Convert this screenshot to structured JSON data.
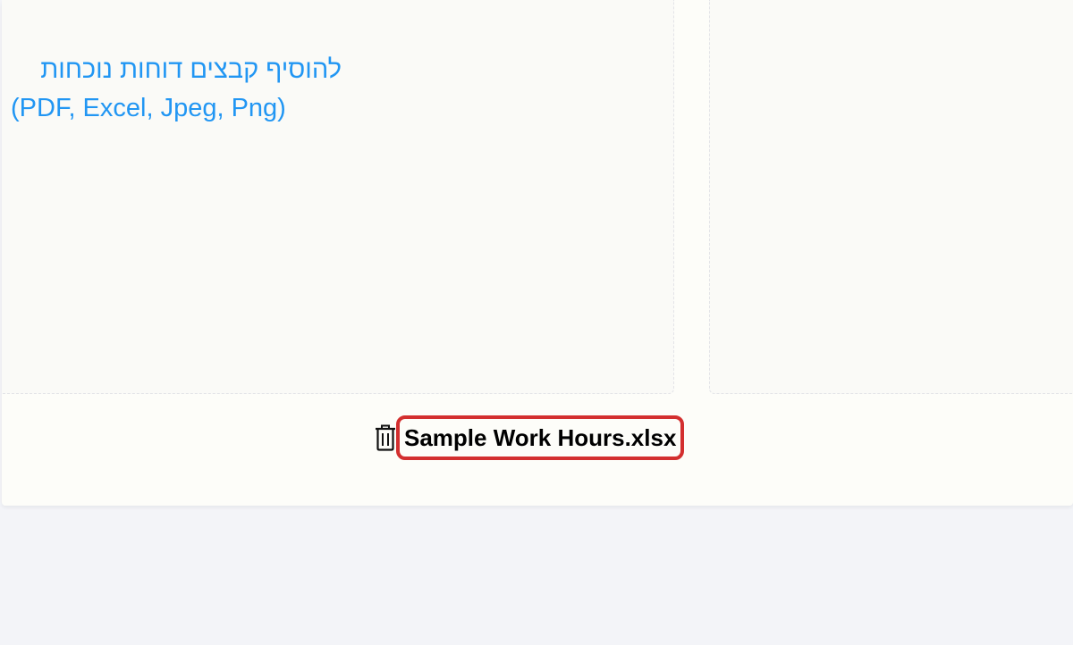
{
  "upload": {
    "title": "להוסיף קבצים דוחות נוכחות",
    "types": "(PDF, Excel, Jpeg, Png)"
  },
  "files": [
    {
      "name": "Sample Work Hours.xlsx",
      "icon": "trash-icon"
    }
  ],
  "colors": {
    "accent": "#2196f3",
    "highlight": "#d32f2f",
    "page_bg": "#f3f4f8",
    "card_bg": "#fdfdf9"
  }
}
